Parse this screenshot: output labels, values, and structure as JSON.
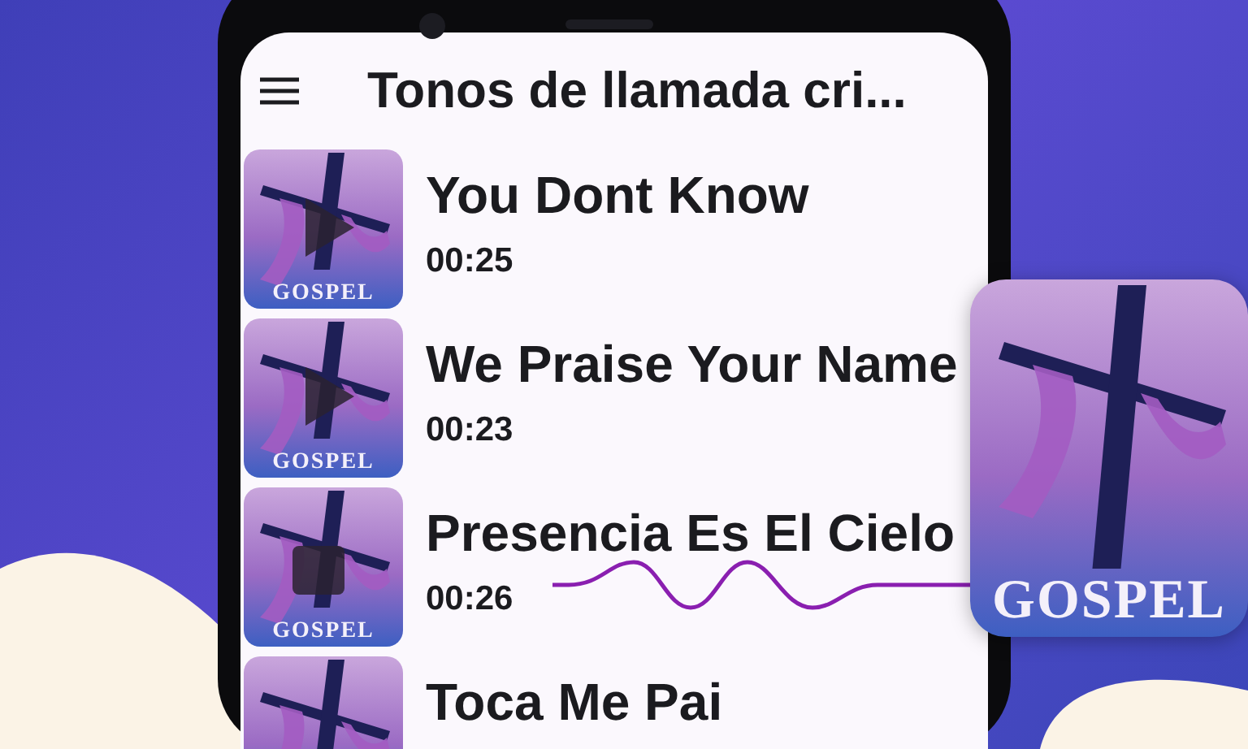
{
  "app_bar": {
    "title": "Tonos de llamada cri..."
  },
  "songs": [
    {
      "title": "You Dont Know",
      "duration": "00:25",
      "art_label": "GOSPEL",
      "playing": false
    },
    {
      "title": "We Praise Your Name",
      "duration": "00:23",
      "art_label": "GOSPEL",
      "playing": false
    },
    {
      "title": "Presencia Es El Cielo",
      "duration": "00:26",
      "art_label": "GOSPEL",
      "playing": true
    },
    {
      "title": "Toca Me Pai"
    }
  ],
  "app_icon": {
    "label": "GOSPEL"
  }
}
